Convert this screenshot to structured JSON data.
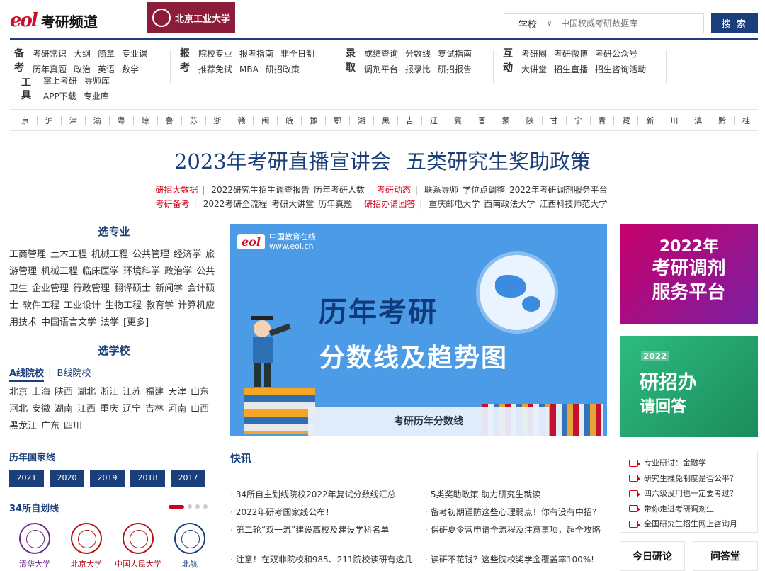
{
  "header": {
    "logo_mark": "eol",
    "logo_text": "考研频道",
    "partner_name": "北京工业大学",
    "search": {
      "select_value": "学校",
      "placeholder": "中国权威考研数据库",
      "button": "搜 索"
    }
  },
  "nav": [
    {
      "cat": "备考",
      "rows": [
        [
          "考研常识",
          "大纲",
          "简章",
          "专业课"
        ],
        [
          "历年真题",
          "政治",
          "英语",
          "数学"
        ]
      ]
    },
    {
      "cat": "报考",
      "rows": [
        [
          "院校专业",
          "报考指南",
          "非全日制"
        ],
        [
          "推荐免试",
          "MBA",
          "研招政策"
        ]
      ]
    },
    {
      "cat": "录取",
      "rows": [
        [
          "成绩查询",
          "分数线",
          "复试指南"
        ],
        [
          "调剂平台",
          "报录比",
          "研招报告"
        ]
      ]
    },
    {
      "cat": "互动",
      "rows": [
        [
          "考研圈",
          "考研微博",
          "考研公众号"
        ],
        [
          "大讲堂",
          "招生直播",
          "招生咨询活动"
        ]
      ]
    }
  ],
  "tools": {
    "cat": "工具",
    "rows": [
      [
        "掌上考研",
        "导师库"
      ],
      [
        "APP下载",
        "专业库"
      ]
    ]
  },
  "provinces": [
    "京",
    "沪",
    "津",
    "渝",
    "粤",
    "琼",
    "鲁",
    "苏",
    "浙",
    "赣",
    "闽",
    "皖",
    "豫",
    "鄂",
    "湘",
    "黑",
    "吉",
    "辽",
    "冀",
    "晋",
    "蒙",
    "陕",
    "甘",
    "宁",
    "青",
    "藏",
    "新",
    "川",
    "滇",
    "黔",
    "桂"
  ],
  "headline": "2023年考研直播宣讲会  五类研究生奖助政策",
  "sublinks": [
    [
      {
        "t": "研招大数据",
        "red": true
      },
      {
        "t": "2022研究生招生调查报告"
      },
      {
        "t": "历年考研人数"
      },
      {
        "t": "考研动态",
        "red": true
      },
      {
        "t": "联系导师"
      },
      {
        "t": "学位点调整"
      },
      {
        "t": "2022年考研调剂服务平台"
      }
    ],
    [
      {
        "t": "考研备考",
        "red": true
      },
      {
        "t": "2022考研全流程"
      },
      {
        "t": "考研大讲堂"
      },
      {
        "t": "历年真题"
      },
      {
        "t": "研招办请回答",
        "red": true
      },
      {
        "t": "重庆邮电大学"
      },
      {
        "t": "西南政法大学"
      },
      {
        "t": "江西科技师范大学"
      }
    ]
  ],
  "majors": {
    "title": "选专业",
    "items": [
      "工商管理",
      "土木工程",
      "机械工程",
      "公共管理",
      "经济学",
      "旅游管理",
      "机械工程",
      "临床医学",
      "环境科学",
      "政治学",
      "公共卫生",
      "企业管理",
      "行政管理",
      "翻译硕士",
      "新闻学",
      "会计硕士",
      "软件工程",
      "工业设计",
      "生物工程",
      "教育学",
      "计算机应用技术",
      "中国语言文学",
      "法学"
    ],
    "more": "[更多]"
  },
  "schools": {
    "title": "选学校",
    "tab_a": "A线院校",
    "tab_b": "B线院校",
    "regions": [
      "北京",
      "上海",
      "陕西",
      "湖北",
      "浙江",
      "江苏",
      "福建",
      "天津",
      "山东",
      "河北",
      "安徽",
      "湖南",
      "江西",
      "重庆",
      "辽宁",
      "吉林",
      "河南",
      "山西",
      "黑龙江",
      "广东",
      "四川"
    ]
  },
  "national_line": {
    "title": "历年国家线",
    "years": [
      "2021",
      "2020",
      "2019",
      "2018",
      "2017"
    ]
  },
  "self_line": {
    "title": "34所自划线",
    "universities": [
      "清华大学",
      "北京大学",
      "中国人民大学",
      "北航"
    ]
  },
  "banner": {
    "brand_mark": "eol",
    "brand": "中国教育在线",
    "brand_url": "www.eol.cn",
    "title1": "历年考研",
    "title2": "分数线及趋势图",
    "caption": "考研历年分数线"
  },
  "news": {
    "title": "快讯",
    "items": [
      "34所自主划线院校2022年复试分数线汇总",
      "5类奖助政策 助力研究生就读",
      "2022年研考国家线公布！",
      "备考初期谨防这些心理弱点！你有没有中招?",
      "第二轮“双一流”建设高校及建设学科名单",
      "保研夏令营申请全流程及注意事项，超全攻略",
      "注意！在双非院校和985、211院校读研有这几",
      "读研不花钱？这些院校奖学金覆盖率100%!"
    ]
  },
  "promo1": {
    "year": "2022年",
    "line1": "考研调剂",
    "line2": "服务平台"
  },
  "promo2": {
    "year": "2022",
    "line1": "研招办",
    "line2": "请回答"
  },
  "right_list": [
    "专业研讨：金融学",
    "研究生推免制度是否公平？",
    "四六级没用也一定要考过？",
    "带你走进考研调剂生",
    "全国研究生招生网上咨询月"
  ],
  "bottom_boxes": [
    "今日研论",
    "问答堂"
  ],
  "colors": {
    "brand_blue": "#1a3f7a",
    "accent_red": "#d0021b",
    "partner": "#8b1d3a"
  }
}
